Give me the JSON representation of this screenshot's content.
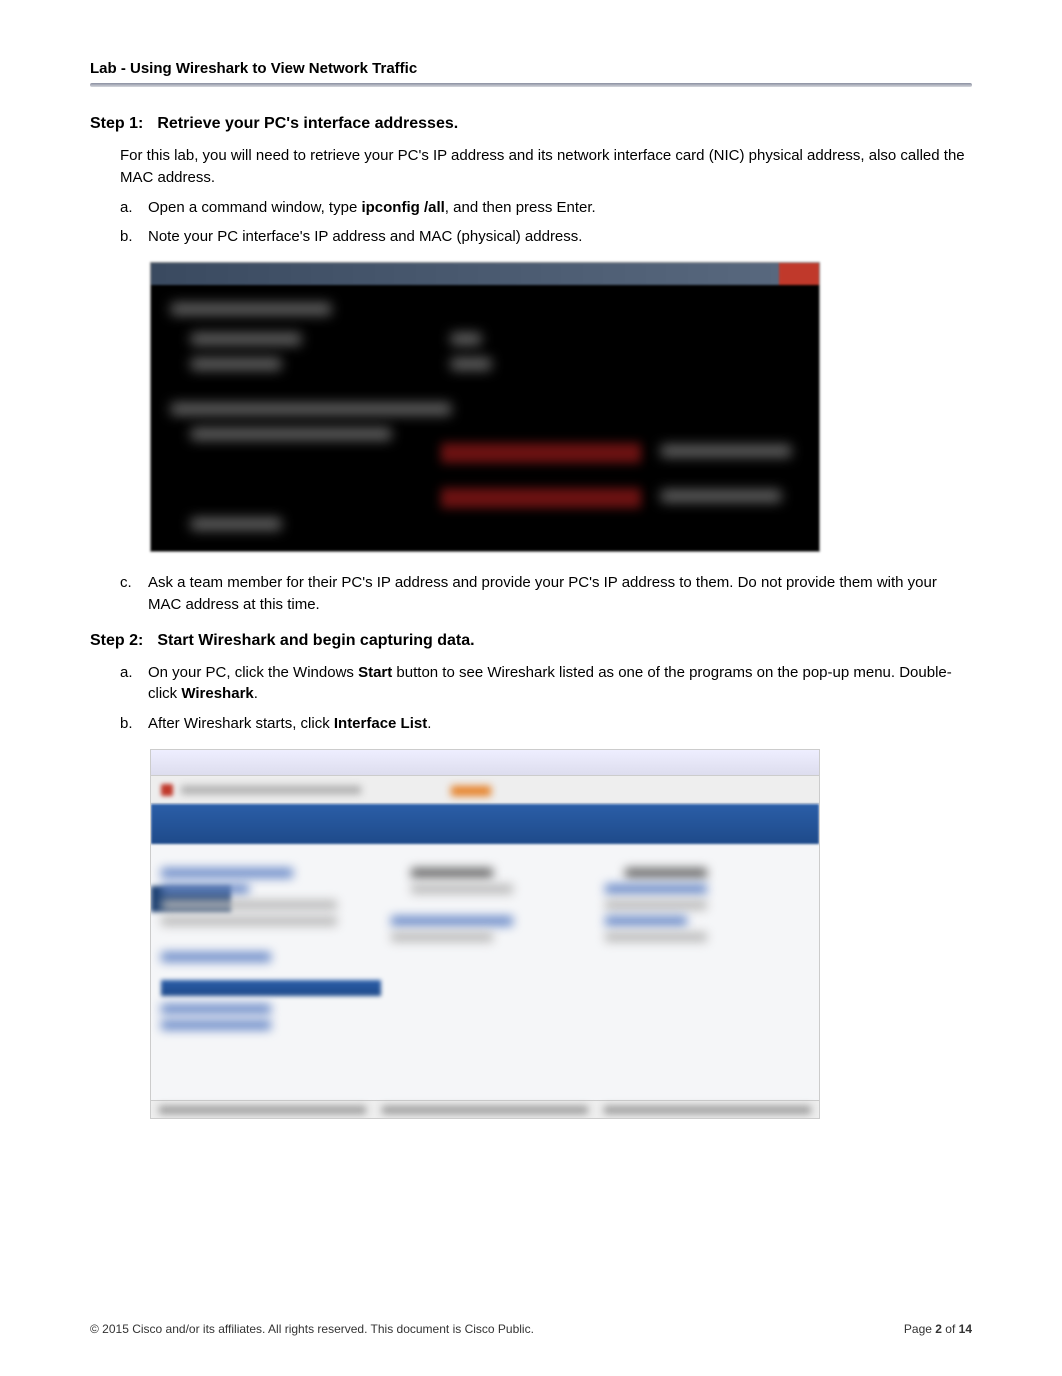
{
  "header": {
    "title": "Lab - Using Wireshark to View Network Traffic"
  },
  "step1": {
    "label": "Step 1:",
    "title": "Retrieve your PC's interface addresses.",
    "intro": "For this lab, you will need to retrieve your PC's IP address and its network interface card (NIC) physical address, also called the MAC address.",
    "a": {
      "letter": "a.",
      "pre": "Open a command window, type ",
      "cmd": "ipconfig /all",
      "post": ", and then press Enter."
    },
    "b": {
      "letter": "b.",
      "text": "Note your PC interface's IP address and MAC (physical) address."
    },
    "c": {
      "letter": "c.",
      "text": "Ask a team member for their PC's IP address and provide your PC's IP address to them. Do not provide them with your MAC address at this time."
    }
  },
  "step2": {
    "label": "Step 2:",
    "title": "Start Wireshark and begin capturing data.",
    "a": {
      "letter": "a.",
      "pre": "On your PC, click the Windows ",
      "bold1": "Start",
      "mid": " button to see Wireshark listed as one of the programs on the pop-up menu. Double-click ",
      "bold2": "Wireshark",
      "post": "."
    },
    "b": {
      "letter": "b.",
      "pre": "After Wireshark starts, click ",
      "bold": "Interface List",
      "post": "."
    }
  },
  "footer": {
    "copyright": "© 2015 Cisco and/or its affiliates. All rights reserved. This document is Cisco Public.",
    "page_pre": "Page ",
    "page_num": "2",
    "page_mid": " of ",
    "page_total": "14"
  }
}
